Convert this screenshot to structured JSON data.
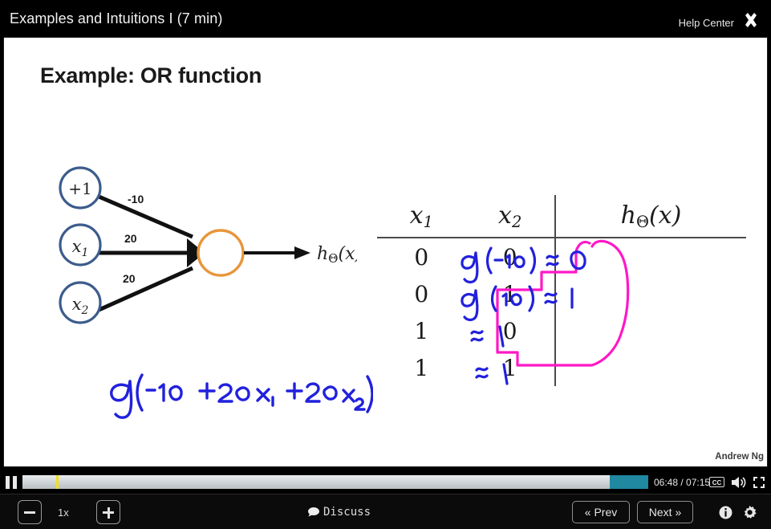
{
  "header": {
    "title": "Examples and Intuitions I (7 min)",
    "help_center": "Help Center",
    "close_icon": "close-icon"
  },
  "slide": {
    "title": "Example: OR function",
    "author": "Andrew Ng",
    "network": {
      "nodes": [
        {
          "label": "+1",
          "name": "bias-node"
        },
        {
          "label": "x1",
          "name": "input-node-x1"
        },
        {
          "label": "x2",
          "name": "input-node-x2"
        },
        {
          "label": "",
          "name": "output-node"
        }
      ],
      "edge_weights": [
        "-10",
        "20",
        "20"
      ],
      "output_label": "hΘ(x)",
      "node_border_color": "#3c5c8c",
      "output_border_color": "#e8953a"
    },
    "handwriting": {
      "formula": "g(-10 + 20 x1 + 20 x2)",
      "ink_color": "#2121dd",
      "highlight_color": "#ff18c6",
      "annotations": [
        "g (-10) ≈ 0",
        "g (10) ≈ 1",
        "≈ 1",
        "≈ 1"
      ]
    },
    "table": {
      "headers": [
        "x1",
        "x2",
        "hΘ(x)"
      ],
      "rows": [
        [
          "0",
          "0"
        ],
        [
          "0",
          "1"
        ],
        [
          "1",
          "0"
        ],
        [
          "1",
          "1"
        ]
      ]
    }
  },
  "player": {
    "pause_icon": "pause-icon",
    "time": "06:48 / 07:15",
    "cc_label": "CC",
    "volume_icon": "volume-icon",
    "fullscreen_icon": "fullscreen-icon",
    "progress_percent": 94,
    "buffer_percent": 100,
    "marker_percent": 5.4
  },
  "toolbar": {
    "speed_down_label": "minus-icon",
    "speed_value": "1x",
    "speed_up_label": "plus-icon",
    "discuss_label": "Discuss",
    "prev_label": "« Prev",
    "next_label": "Next »",
    "info_icon": "info-icon",
    "settings_icon": "gear-icon"
  }
}
